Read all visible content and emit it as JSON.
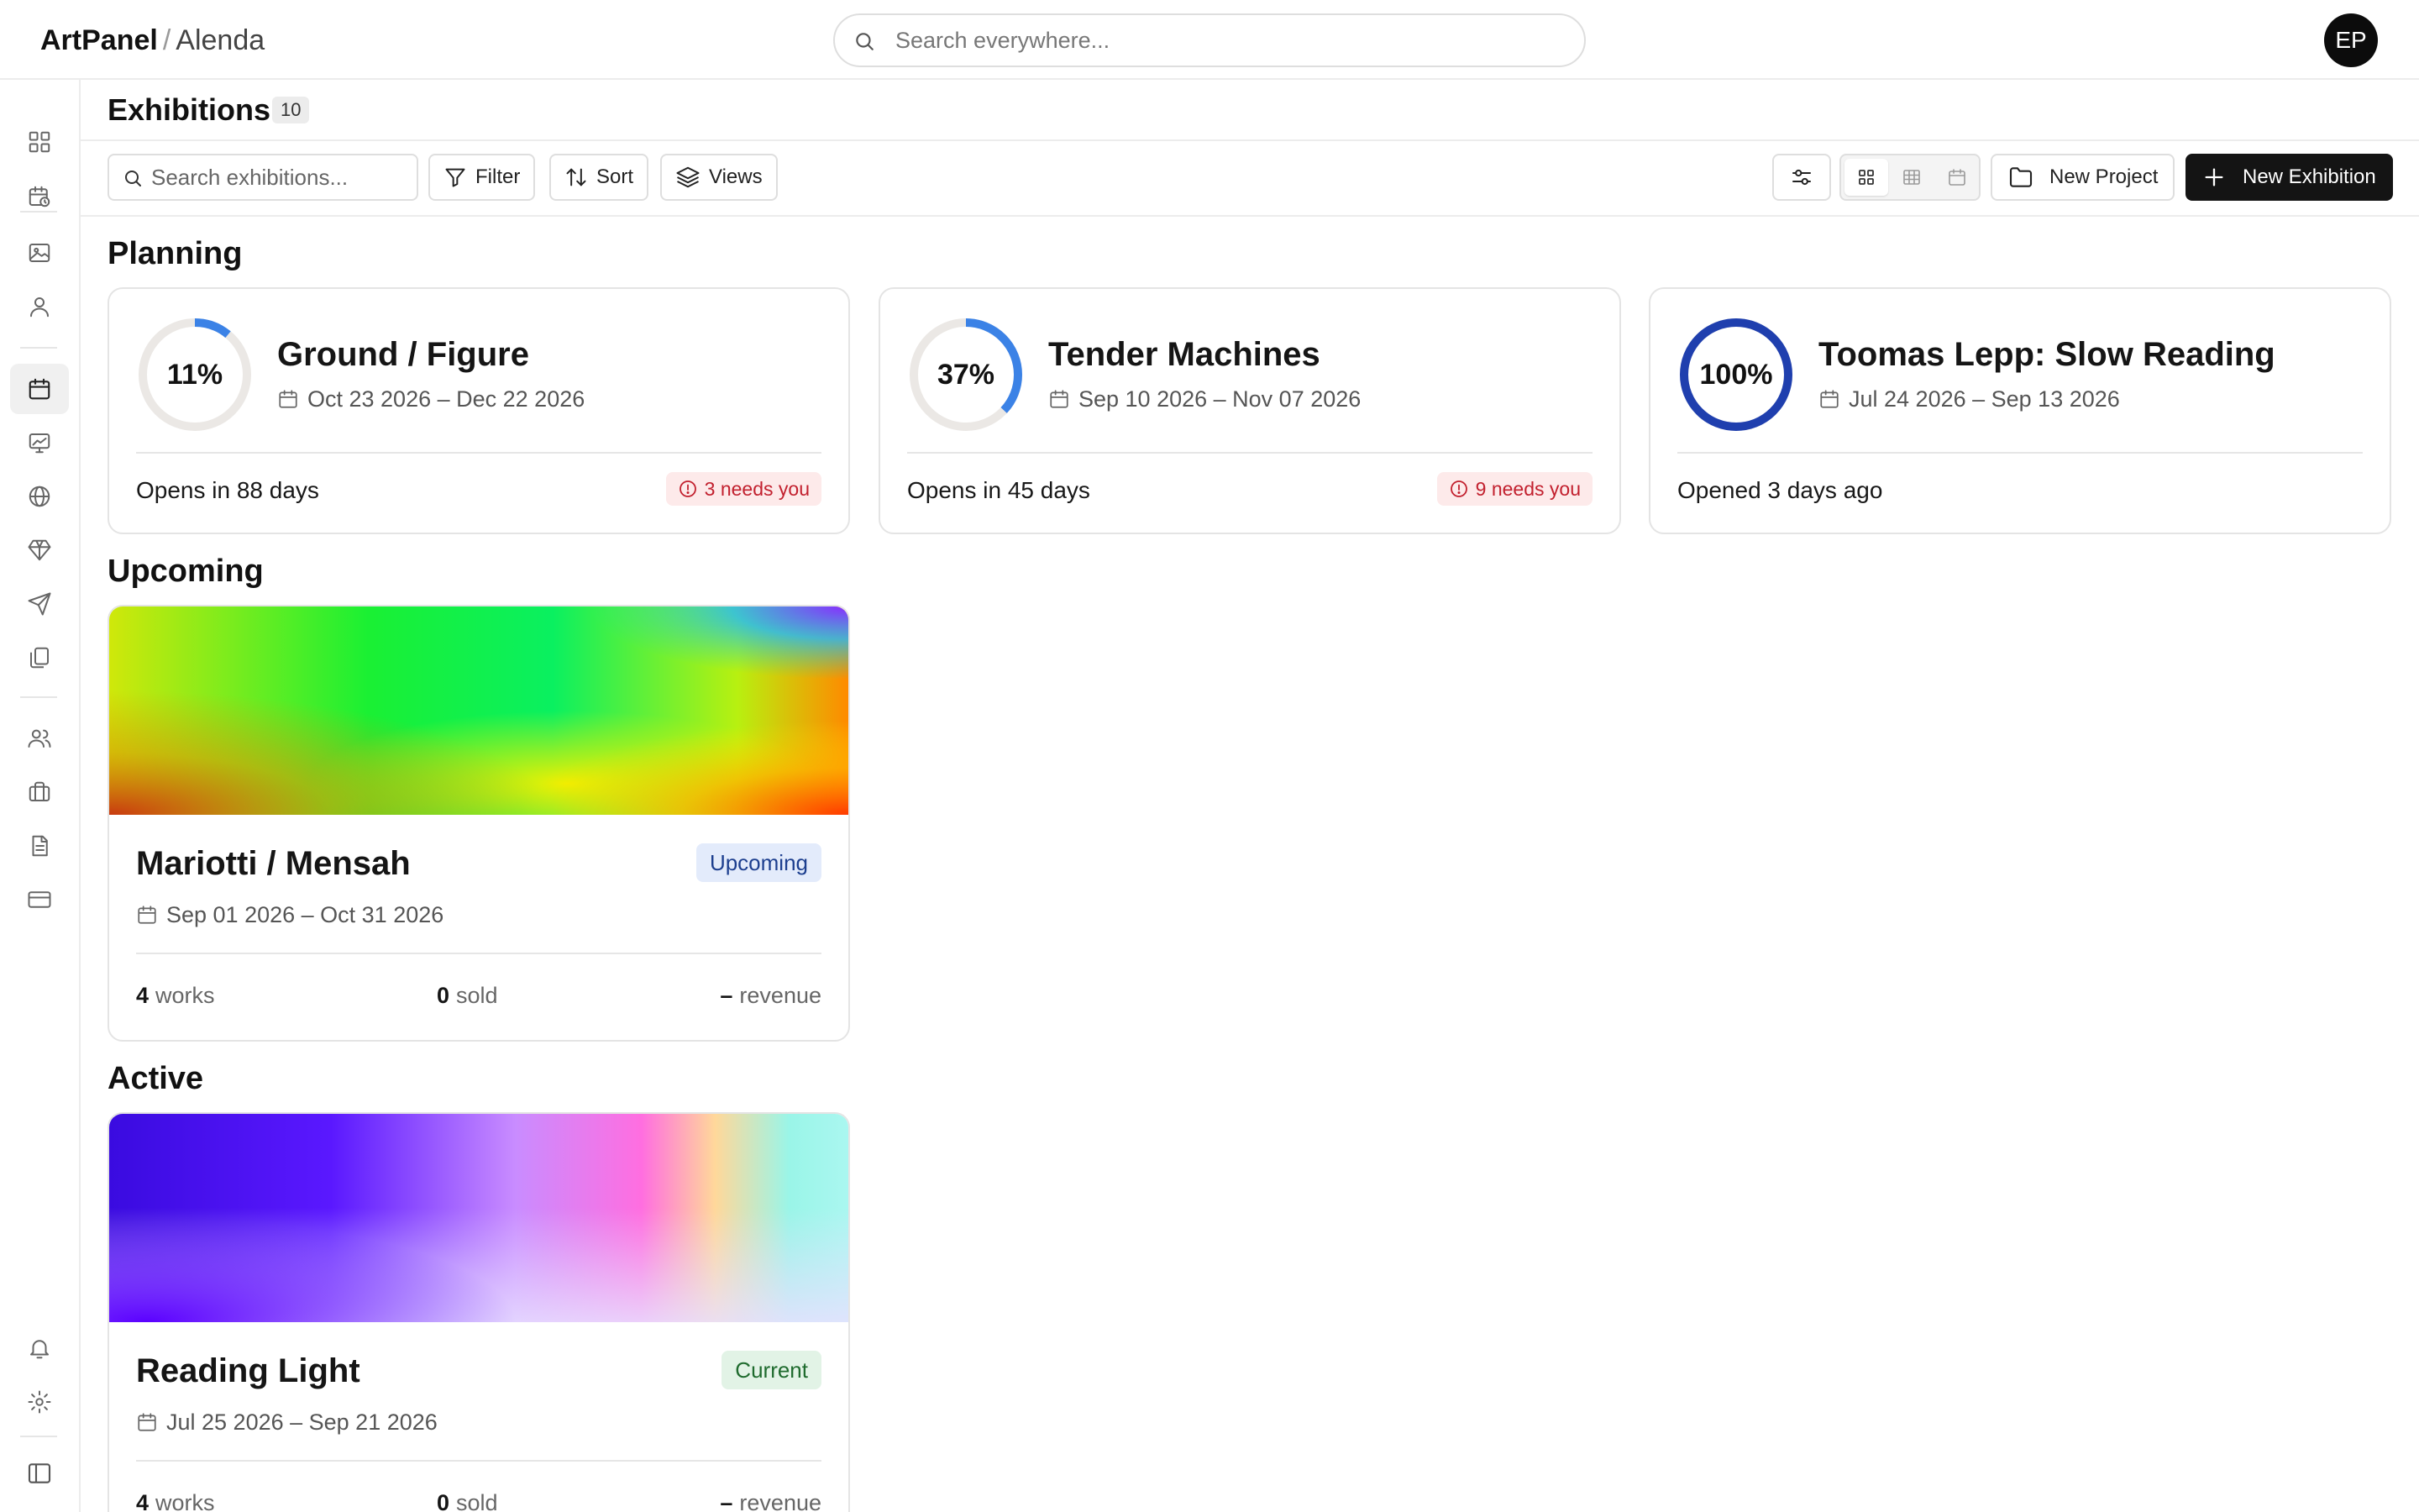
{
  "header": {
    "app_name": "ArtPanel",
    "separator": "/",
    "workspace": "Alenda",
    "search_placeholder": "Search everywhere...",
    "avatar_initials": "EP"
  },
  "sidebar": {
    "icons": [
      "dashboard-icon",
      "calendar-clock-icon",
      "image-icon",
      "user-icon",
      "calendar-icon",
      "monitor-image-icon",
      "globe-icon",
      "gem-icon",
      "send-icon",
      "copy-icon",
      "users-icon",
      "briefcase-icon",
      "document-icon",
      "credit-card-icon",
      "bell-icon",
      "gear-icon",
      "sidebar-toggle-icon"
    ],
    "active": "calendar-icon"
  },
  "page": {
    "title": "Exhibitions",
    "count": "10"
  },
  "toolbar": {
    "search_placeholder": "Search exhibitions...",
    "filter_label": "Filter",
    "sort_label": "Sort",
    "views_label": "Views",
    "view_mode_selected": "grid",
    "new_project_label": "New Project",
    "new_exhibition_label": "New Exhibition"
  },
  "sections": {
    "planning": {
      "title": "Planning",
      "cards": [
        {
          "progress": 0.11,
          "progress_label": "11%",
          "ring_color": "#3b82e6",
          "title": "Ground / Figure",
          "dates": "Oct 23 2026 – Dec 22 2026",
          "status": "Opens in 88 days",
          "needs": "3 needs you"
        },
        {
          "progress": 0.37,
          "progress_label": "37%",
          "ring_color": "#3b82e6",
          "title": "Tender Machines",
          "dates": "Sep 10 2026 – Nov 07 2026",
          "status": "Opens in 45 days",
          "needs": "9 needs you"
        },
        {
          "progress": 1.0,
          "progress_label": "100%",
          "ring_color": "#1f3fae",
          "title": "Toomas Lepp: Slow Reading",
          "dates": "Jul 24 2026 – Sep 13 2026",
          "status": "Opened 3 days ago",
          "needs": ""
        }
      ]
    },
    "upcoming": {
      "title": "Upcoming",
      "cards": [
        {
          "title": "Mariotti / Mensah",
          "status": "Upcoming",
          "status_bg": "#e3ebfb",
          "status_fg": "#1d3f8f",
          "dates": "Sep 01 2026 – Oct 31 2026",
          "works": "4",
          "works_label": "works",
          "sold": "0",
          "sold_label": "sold",
          "revenue": "–",
          "revenue_label": "revenue"
        }
      ]
    },
    "active": {
      "title": "Active",
      "cards": [
        {
          "title": "Reading Light",
          "status": "Current",
          "status_bg": "#e2f3e6",
          "status_fg": "#1f6b2e",
          "dates": "Jul 25 2026 – Sep 21 2026",
          "works": "4",
          "works_label": "works",
          "sold": "0",
          "sold_label": "sold",
          "revenue": "–",
          "revenue_label": "revenue"
        }
      ]
    }
  }
}
